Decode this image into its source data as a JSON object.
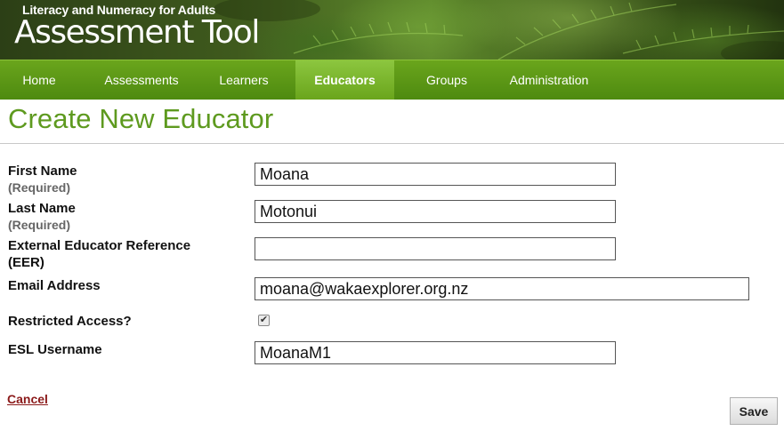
{
  "banner": {
    "subtitle": "Literacy and Numeracy for Adults",
    "title": "Assessment Tool"
  },
  "nav": {
    "items": [
      {
        "label": "Home"
      },
      {
        "label": "Assessments"
      },
      {
        "label": "Learners"
      },
      {
        "label": "Educators",
        "active": true
      },
      {
        "label": "Groups"
      },
      {
        "label": "Administration"
      }
    ]
  },
  "page": {
    "title": "Create New Educator"
  },
  "form": {
    "first_name": {
      "label": "First Name",
      "note": "(Required)",
      "value": "Moana"
    },
    "last_name": {
      "label": "Last Name",
      "note": "(Required)",
      "value": "Motonui"
    },
    "eer": {
      "label_line1": "External Educator Reference",
      "label_line2": "(EER)",
      "value": ""
    },
    "email": {
      "label": "Email Address",
      "value": "moana@wakaexplorer.org.nz"
    },
    "restricted": {
      "label": "Restricted Access?",
      "checked": true
    },
    "esl": {
      "label": "ESL Username",
      "value": "MoanaM1"
    }
  },
  "actions": {
    "cancel_label": "Cancel",
    "save_label": "Save"
  },
  "colors": {
    "nav_green": "#5a9716",
    "title_green": "#5e9a1f",
    "cancel_red": "#8b1a1a"
  }
}
